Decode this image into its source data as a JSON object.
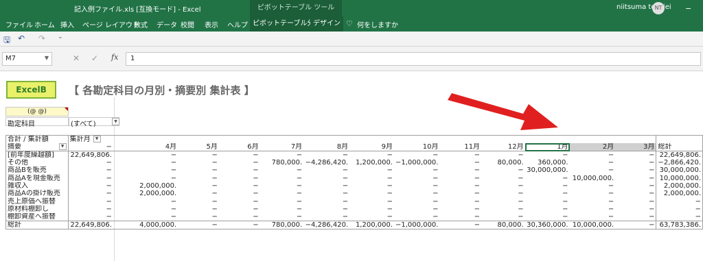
{
  "window": {
    "title": "記入例ファイル.xls [互換モード] - Excel",
    "context_tab": "ピボットテーブル ツール",
    "user": "niitsuma toshiei",
    "avatar": "NT",
    "minimize": "−"
  },
  "ribbon": {
    "tabs": [
      "ファイル",
      "ホーム",
      "挿入",
      "ページ レイアウト",
      "数式",
      "データ",
      "校閲",
      "表示",
      "ヘルプ",
      "ピボットテーブル分析",
      "デザイン"
    ],
    "tellme": "何をしますか",
    "bulb": "♡"
  },
  "qat": {
    "save": "🖫",
    "undo": "↶",
    "redo": "↷",
    "more": "⌄"
  },
  "formula_bar": {
    "name_box": "M7",
    "name_dd": "▼",
    "cancel": "✕",
    "enter": "✓",
    "fx": "fx",
    "value": "1"
  },
  "sheet": {
    "logo": "ExcelB",
    "title": "【 各勘定科目の月別・摘要別 集計表 】",
    "tag": "(@ @)",
    "filter_label": "勘定科目",
    "filter_value": "(すべて)",
    "dd": "▼"
  },
  "pivot": {
    "corner": "合計 / 集計額",
    "col_field": "集計月",
    "row_field": "摘要",
    "months": [
      "−",
      "4月",
      "5月",
      "6月",
      "7月",
      "8月",
      "9月",
      "10月",
      "11月",
      "12月",
      "1月",
      "2月",
      "3月"
    ],
    "grand_total_label": "総計",
    "rows": [
      {
        "label": "[前年度繰越額]",
        "values": [
          "22,649,806.",
          "−",
          "−",
          "−",
          "−",
          "−",
          "−",
          "−",
          "−",
          "−",
          "−",
          "−",
          "−"
        ],
        "total": "22,649,806."
      },
      {
        "label": "その他",
        "values": [
          "−",
          "−",
          "−",
          "−",
          "780,000.",
          "−4,286,420.",
          "1,200,000.",
          "−1,000,000.",
          "−",
          "80,000.",
          "360,000.",
          "−",
          "−"
        ],
        "total": "−2,866,420."
      },
      {
        "label": "商品Bを販売",
        "values": [
          "−",
          "−",
          "−",
          "−",
          "−",
          "−",
          "−",
          "−",
          "−",
          "−",
          "30,000,000.",
          "−",
          "−"
        ],
        "total": "30,000,000."
      },
      {
        "label": "商品Aを現金販売",
        "values": [
          "−",
          "−",
          "−",
          "−",
          "−",
          "−",
          "−",
          "−",
          "−",
          "−",
          "−",
          "10,000,000.",
          "−"
        ],
        "total": "10,000,000."
      },
      {
        "label": "雑収入",
        "values": [
          "−",
          "2,000,000.",
          "−",
          "−",
          "−",
          "−",
          "−",
          "−",
          "−",
          "−",
          "−",
          "−",
          "−"
        ],
        "total": "2,000,000."
      },
      {
        "label": "商品Aの掛け販売",
        "values": [
          "−",
          "2,000,000.",
          "−",
          "−",
          "−",
          "−",
          "−",
          "−",
          "−",
          "−",
          "−",
          "−",
          "−"
        ],
        "total": "2,000,000."
      },
      {
        "label": "売上原価へ振替",
        "values": [
          "−",
          "−",
          "−",
          "−",
          "−",
          "−",
          "−",
          "−",
          "−",
          "−",
          "−",
          "−",
          "−"
        ],
        "total": "−"
      },
      {
        "label": "原材料棚卸し",
        "values": [
          "−",
          "−",
          "−",
          "−",
          "−",
          "−",
          "−",
          "−",
          "−",
          "−",
          "−",
          "−",
          "−"
        ],
        "total": "−"
      },
      {
        "label": "棚卸資産へ振替",
        "values": [
          "−",
          "−",
          "−",
          "−",
          "−",
          "−",
          "−",
          "−",
          "−",
          "−",
          "−",
          "−",
          "−"
        ],
        "total": "−"
      }
    ],
    "total_row": {
      "label": "総計",
      "values": [
        "22,649,806.",
        "4,000,000.",
        "−",
        "−",
        "780,000.",
        "−4,286,420.",
        "1,200,000.",
        "−1,000,000.",
        "−",
        "80,000.",
        "30,360,000.",
        "10,000,000.",
        "−"
      ],
      "total": "63,783,386."
    }
  },
  "colors": {
    "excel_green": "#217346",
    "arrow_red": "#e02020"
  }
}
